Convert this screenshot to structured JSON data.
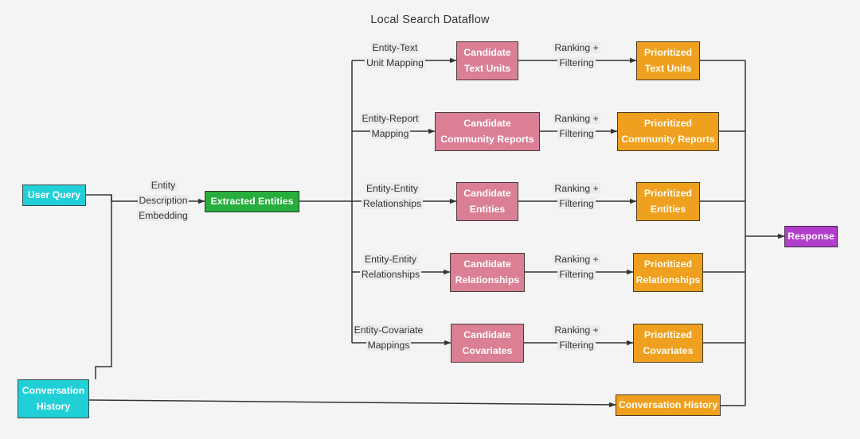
{
  "diagram": {
    "title": "Local Search Dataflow",
    "background_color": "#f4f4f4",
    "edge_color": "#333333",
    "colors": {
      "cyan": "#21d0d7",
      "green": "#27ae3d",
      "pink": "#da7f94",
      "orange": "#efa01e",
      "purple": "#b03ecb"
    }
  },
  "nodes": {
    "user_query": "User Query",
    "conversation_history_input": "Conversation History",
    "extracted_entities": "Extracted Entities",
    "candidate_text_units": "Candidate\nText Units",
    "candidate_community_reports": "Candidate\nCommunity Reports",
    "candidate_entities": "Candidate\nEntities",
    "candidate_relationships": "Candidate\nRelationships",
    "candidate_covariates": "Candidate\nCovariates",
    "prioritized_text_units": "Prioritized\nText Units",
    "prioritized_community_reports": "Prioritized\nCommunity Reports",
    "prioritized_entities": "Prioritized\nEntities",
    "prioritized_relationships": "Prioritized\nRelationships",
    "prioritized_covariates": "Prioritized\nCovariates",
    "conversation_history_output": "Conversation History",
    "response": "Response"
  },
  "edge_labels": {
    "entity_description_embedding": "Entity\nDescription\nEmbedding",
    "entity_text_unit_mapping": "Entity-Text\nUnit Mapping",
    "entity_report_mapping": "Entity-Report\nMapping",
    "entity_entity_relationships_1": "Entity-Entity\nRelationships",
    "entity_entity_relationships_2": "Entity-Entity\nRelationships",
    "entity_covariate_mappings": "Entity-Covariate\nMappings",
    "ranking_filtering_1": "Ranking +\nFiltering",
    "ranking_filtering_2": "Ranking +\nFiltering",
    "ranking_filtering_3": "Ranking +\nFiltering",
    "ranking_filtering_4": "Ranking +\nFiltering",
    "ranking_filtering_5": "Ranking +\nFiltering"
  }
}
